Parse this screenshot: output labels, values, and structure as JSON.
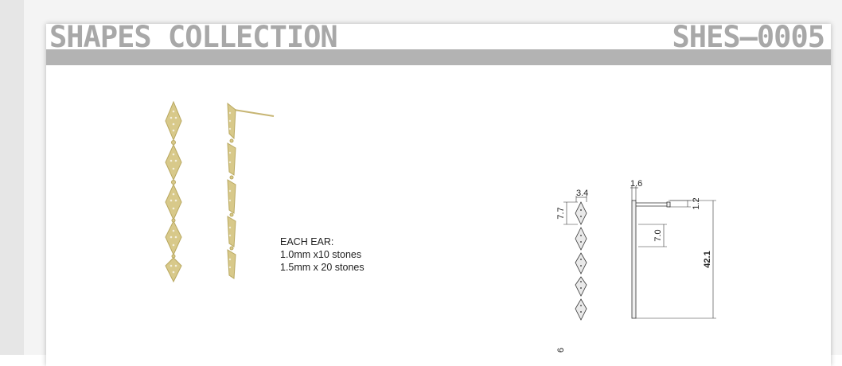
{
  "header": {
    "collection_title": "SHAPES COLLECTION",
    "product_code": "SHES–0005"
  },
  "notes": {
    "heading": "EACH EAR:",
    "line1": "1.0mm x10 stones",
    "line2": "1.5mm x 20 stones"
  },
  "dimensions": {
    "width_top": "3.4",
    "height_segment": "7.7",
    "post_width": "1.6",
    "post_offset": "1.2",
    "segment_length": "7.0",
    "total_length": "42.1",
    "partial_label": "6"
  },
  "colors": {
    "gold": "#d8c98a",
    "gold_dark": "#b9a860",
    "header_gray": "#b3b3b3",
    "title_gray": "#a8a8a8"
  }
}
